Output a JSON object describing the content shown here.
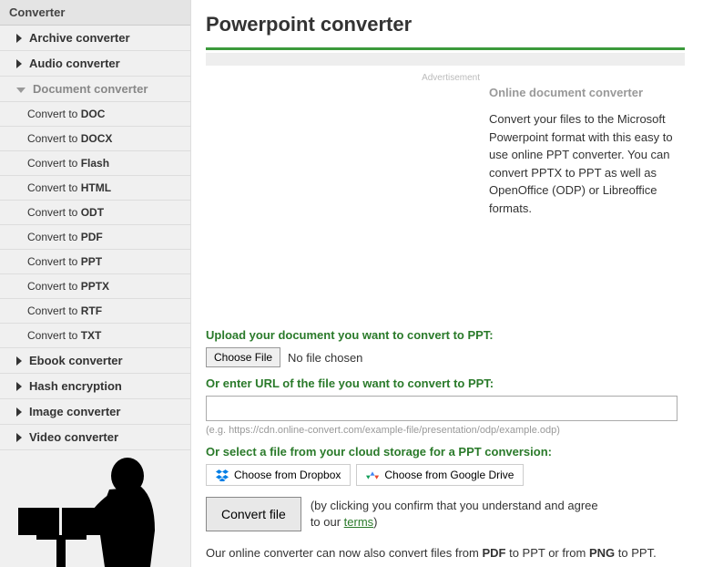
{
  "sidebar": {
    "header": "Converter",
    "categories": [
      {
        "label": "Archive converter"
      },
      {
        "label": "Audio converter"
      },
      {
        "label": "Document converter",
        "expanded": true
      },
      {
        "label": "Ebook converter"
      },
      {
        "label": "Hash encryption"
      },
      {
        "label": "Image converter"
      },
      {
        "label": "Video converter"
      }
    ],
    "subitems": [
      {
        "prefix": "Convert to ",
        "fmt": "DOC"
      },
      {
        "prefix": "Convert to ",
        "fmt": "DOCX"
      },
      {
        "prefix": "Convert to ",
        "fmt": "Flash"
      },
      {
        "prefix": "Convert to ",
        "fmt": "HTML"
      },
      {
        "prefix": "Convert to ",
        "fmt": "ODT"
      },
      {
        "prefix": "Convert to ",
        "fmt": "PDF"
      },
      {
        "prefix": "Convert to ",
        "fmt": "PPT"
      },
      {
        "prefix": "Convert to ",
        "fmt": "PPTX"
      },
      {
        "prefix": "Convert to ",
        "fmt": "RTF"
      },
      {
        "prefix": "Convert to ",
        "fmt": "TXT"
      }
    ]
  },
  "main": {
    "title": "Powerpoint converter",
    "ad_label": "Advertisement",
    "desc_title": "Online document converter",
    "desc_text": "Convert your files to the Microsoft Powerpoint format with this easy to use online PPT converter. You can convert PPTX to PPT as well as OpenOffice (ODP) or Libreoffice formats.",
    "upload_label": "Upload your document you want to convert to PPT:",
    "choose_file": "Choose File",
    "no_file": "No file chosen",
    "url_label": "Or enter URL of the file you want to convert to PPT:",
    "url_example": "(e.g. https://cdn.online-convert.com/example-file/presentation/odp/example.odp)",
    "cloud_label": "Or select a file from your cloud storage for a PPT conversion:",
    "dropbox_btn": "Choose from Dropbox",
    "gdrive_btn": "Choose from Google Drive",
    "convert_btn": "Convert file",
    "convert_note_1": "(by clicking you confirm that you understand and agree to our ",
    "terms_text": "terms",
    "convert_note_2": ")",
    "footer_1": "Our online converter can now also convert files from ",
    "footer_pdf": "PDF",
    "footer_2": " to PPT or from ",
    "footer_png": "PNG",
    "footer_3": " to PPT."
  }
}
